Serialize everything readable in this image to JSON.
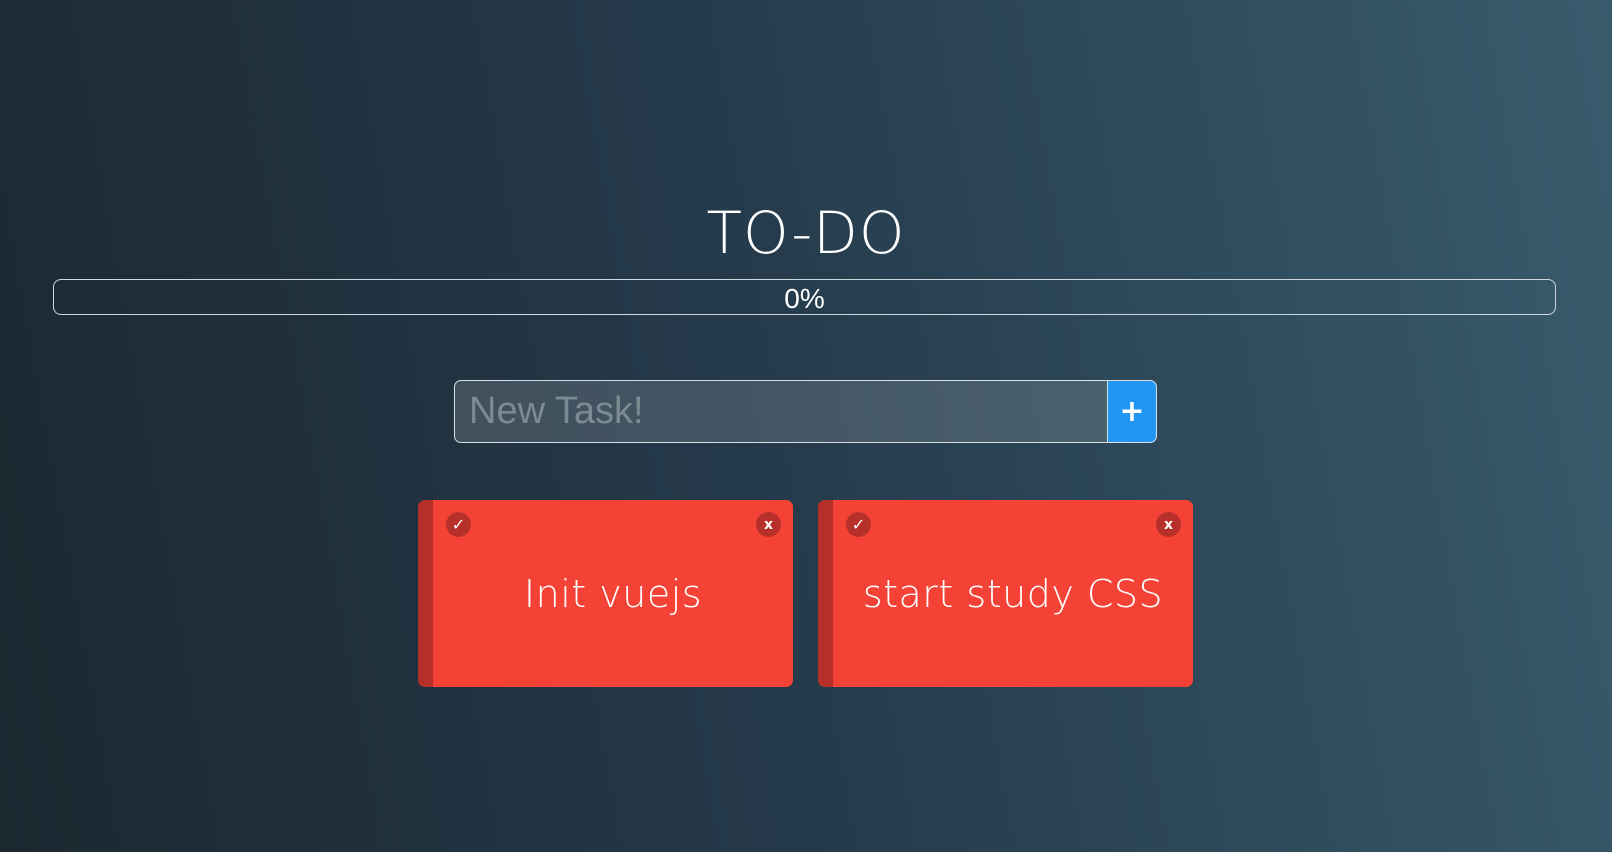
{
  "app": {
    "title": "TO-DO"
  },
  "progress": {
    "label": "0%",
    "value": 0
  },
  "new_task": {
    "placeholder": "New Task!",
    "value": "",
    "add_label": "+"
  },
  "tasks": [
    {
      "text": "Init vuejs",
      "done_label": "✓",
      "delete_label": "x"
    },
    {
      "text": "start study CSS",
      "done_label": "✓",
      "delete_label": "x"
    }
  ],
  "colors": {
    "accent": "#2196f3",
    "card": "#f44336",
    "card_edge": "#b53029"
  }
}
